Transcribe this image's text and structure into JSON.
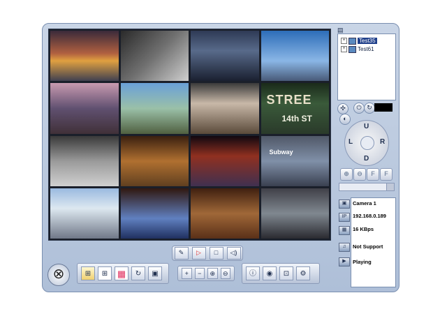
{
  "cameras": {
    "labels": [
      "",
      "",
      "",
      "",
      "",
      "",
      "",
      "",
      "",
      "",
      "",
      "",
      "",
      "",
      "",
      ""
    ],
    "street_sign": "STREE",
    "street_sub": "14th ST",
    "subway_sign": "Subway"
  },
  "tree": {
    "items": [
      {
        "label": "Test35",
        "selected": true
      },
      {
        "label": "Test61",
        "selected": false
      }
    ]
  },
  "ptz": {
    "up": "U",
    "down": "D",
    "left": "L",
    "right": "R",
    "zoom_labels": [
      "F",
      "F"
    ]
  },
  "info": {
    "camera": "Camera 1",
    "ip": "192.168.0.189",
    "bitrate": "16 KBps",
    "audio": "Not Support",
    "status": "Playing"
  },
  "icons": {
    "close": "close-icon",
    "play": "play-icon",
    "stop": "stop-icon",
    "speaker": "speaker-icon",
    "mic": "microphone-icon"
  },
  "colors": {
    "accent": "#1f3f8a",
    "frame": "#aebfd8"
  }
}
